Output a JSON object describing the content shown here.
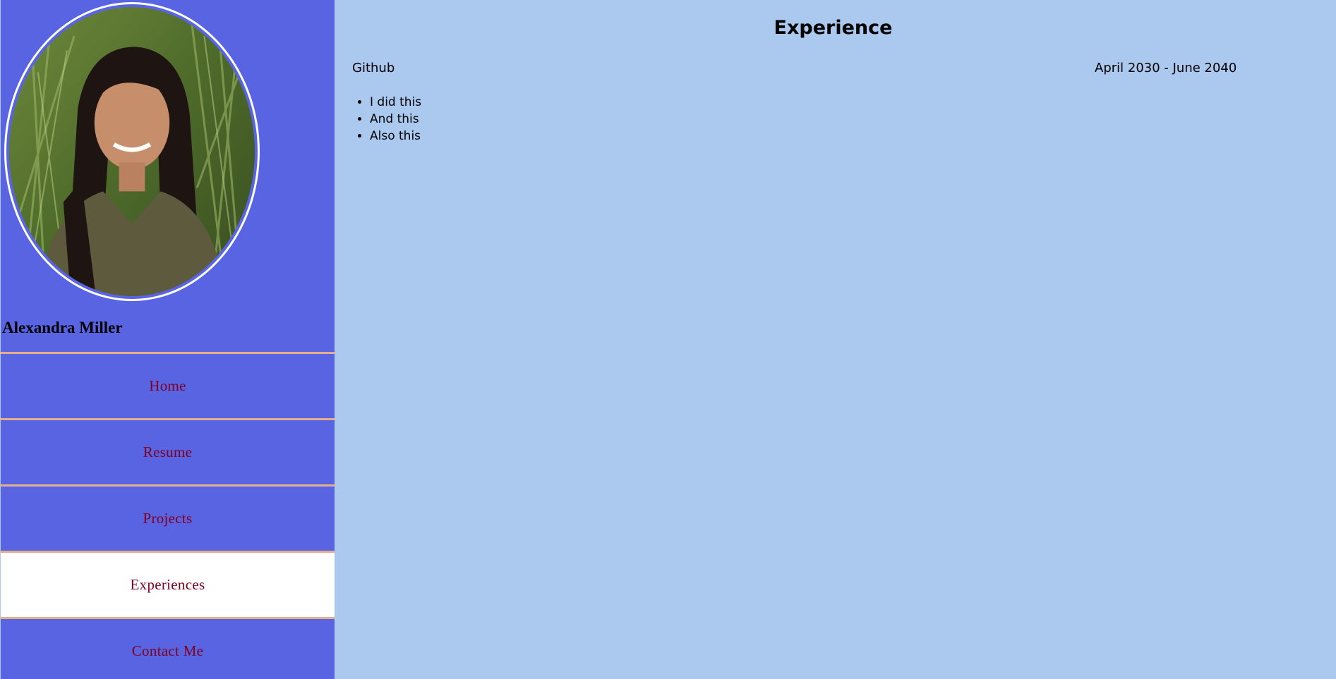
{
  "sidebar": {
    "profile_name": "Alexandra Miller",
    "nav": [
      {
        "label": "Home",
        "active": false
      },
      {
        "label": "Resume",
        "active": false
      },
      {
        "label": "Projects",
        "active": false
      },
      {
        "label": "Experiences",
        "active": true
      },
      {
        "label": "Contact Me",
        "active": false
      }
    ]
  },
  "main": {
    "title": "Experience",
    "experience": {
      "company": "Github",
      "dates": "April 2030 - June 2040",
      "bullets": [
        "I did this",
        "And this",
        "Also this"
      ]
    }
  },
  "colors": {
    "page_background": "#abc9ee",
    "sidebar_background": "#5964e2",
    "nav_divider": "#e6ad8a",
    "nav_text": "#800020",
    "active_nav_background": "#ffffff"
  }
}
